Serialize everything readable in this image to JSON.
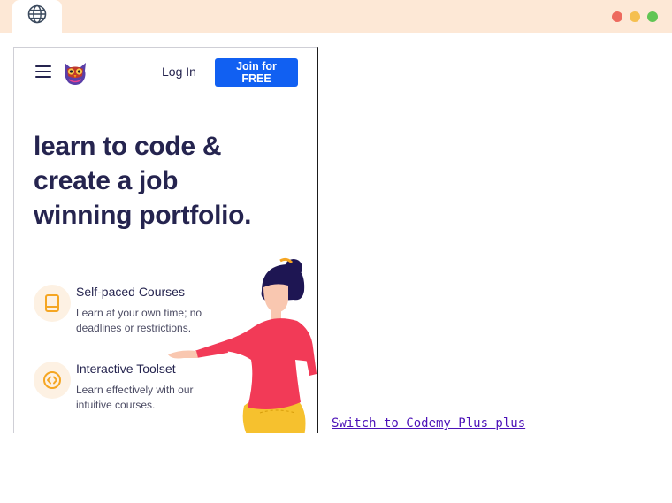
{
  "browser": {
    "tab_icon": "globe-icon",
    "window_controls": [
      "close",
      "minimize",
      "maximize"
    ],
    "colors": {
      "chrome": "#fde8d6",
      "close": "#ed6a5e",
      "minimize": "#f5bf4f",
      "maximize": "#61c554"
    }
  },
  "site": {
    "nav": {
      "menu_icon": "hamburger-menu-icon",
      "logo_icon": "owl-logo-icon",
      "login_label": "Log In",
      "join_label": "Join for FREE"
    },
    "hero": {
      "title_lines": [
        "learn to code &",
        "create a job",
        "winning portfolio."
      ]
    },
    "features": [
      {
        "icon": "book-icon",
        "title": "Self-paced Courses",
        "desc_lines": [
          "Learn at your own time; no",
          "deadlines or restrictions."
        ]
      },
      {
        "icon": "code-icon",
        "title": "Interactive Toolset",
        "desc_lines": [
          "Learn effectively with our",
          "intuitive courses."
        ]
      }
    ],
    "colors": {
      "primary": "#1160f2",
      "heading": "#25244f",
      "accent": "#f5a623"
    }
  },
  "switch_link": {
    "label": "Switch to Codemy Plus plus",
    "color": "#4c12b8"
  }
}
